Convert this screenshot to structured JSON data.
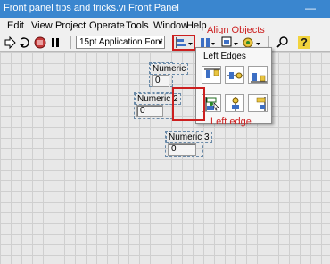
{
  "window": {
    "title": "Front panel tips and tricks.vi Front Panel",
    "minimize_glyph": "—"
  },
  "menu": [
    "Edit",
    "View",
    "Project",
    "Operate",
    "Tools",
    "Window",
    "Help"
  ],
  "toolbar": {
    "icons": [
      "run-arrow-icon",
      "run-continuously-icon",
      "abort-icon",
      "pause-icon"
    ],
    "font_select": "15pt Application Font",
    "dropdown_glyph": "▾",
    "right_icons": [
      "distribute-objects-icon",
      "resize-objects-icon",
      "reorder-icon",
      "search-icon",
      "help-icon"
    ],
    "help_glyph": "?"
  },
  "numerics": [
    {
      "label": "Numeric",
      "value": "0"
    },
    {
      "label": "Numeric 2",
      "value": "0"
    },
    {
      "label": "Numeric 3",
      "value": "0"
    }
  ],
  "palette": {
    "caption": "Left Edges",
    "buttons": [
      "top-edges",
      "vertical-centers",
      "bottom-edges",
      "left-edges",
      "horizontal-centers",
      "right-edges"
    ],
    "selected": "left-edges"
  },
  "annotations": {
    "align_objects": "Align Objects",
    "left_edge": "Left edge"
  },
  "colors": {
    "titlebar": "#3a86cf",
    "annotation": "#cc1f1f",
    "panel_grid": "#cfcfcf"
  }
}
